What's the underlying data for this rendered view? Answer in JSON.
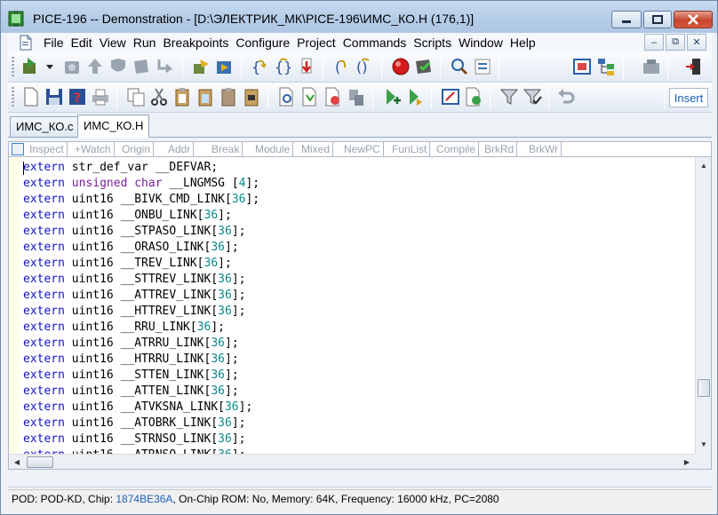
{
  "window": {
    "title": "PICE-196 -- Demonstration - [D:\\ЭЛЕКТРИК_МК\\PICE-196\\ИМС_КО.H (176,1)]"
  },
  "menu": {
    "items": [
      "File",
      "Edit",
      "View",
      "Run",
      "Breakpoints",
      "Configure",
      "Project",
      "Commands",
      "Scripts",
      "Window",
      "Help"
    ]
  },
  "toolbar": {
    "insert_mode": "Insert"
  },
  "tabs": [
    "ИМС_КО.c",
    "ИМС_КО.H"
  ],
  "editor_toolbar": [
    "Inspect",
    "+Watch",
    "Origin",
    "Addr",
    "Break",
    "Module",
    "Mixed",
    "NewPC",
    "FunList",
    "Compile",
    "BrkRd",
    "BrkWr"
  ],
  "code": [
    {
      "kw": "extern",
      "ty": "",
      "plain": " str_def_var __DEFVAR;",
      "num": "",
      "tail": ""
    },
    {
      "kw": "extern",
      "ty": " unsigned char",
      "plain": " __LNGMSG [",
      "num": "4",
      "tail": "];"
    },
    {
      "kw": "extern",
      "ty": "",
      "plain": " uint16 __BIVK_CMD_LINK[",
      "num": "36",
      "tail": "];"
    },
    {
      "kw": "extern",
      "ty": "",
      "plain": " uint16 __ONBU_LINK[",
      "num": "36",
      "tail": "];"
    },
    {
      "kw": "extern",
      "ty": "",
      "plain": " uint16 __STPASO_LINK[",
      "num": "36",
      "tail": "];"
    },
    {
      "kw": "extern",
      "ty": "",
      "plain": " uint16 __ORASO_LINK[",
      "num": "36",
      "tail": "];"
    },
    {
      "kw": "extern",
      "ty": "",
      "plain": " uint16 __TREV_LINK[",
      "num": "36",
      "tail": "];"
    },
    {
      "kw": "extern",
      "ty": "",
      "plain": " uint16 __STTREV_LINK[",
      "num": "36",
      "tail": "];"
    },
    {
      "kw": "extern",
      "ty": "",
      "plain": " uint16 __ATTREV_LINK[",
      "num": "36",
      "tail": "];"
    },
    {
      "kw": "extern",
      "ty": "",
      "plain": " uint16 __HTTREV_LINK[",
      "num": "36",
      "tail": "];"
    },
    {
      "kw": "extern",
      "ty": "",
      "plain": " uint16 __RRU_LINK[",
      "num": "36",
      "tail": "];"
    },
    {
      "kw": "extern",
      "ty": "",
      "plain": " uint16 __ATRRU_LINK[",
      "num": "36",
      "tail": "];"
    },
    {
      "kw": "extern",
      "ty": "",
      "plain": " uint16 __HTRRU_LINK[",
      "num": "36",
      "tail": "];"
    },
    {
      "kw": "extern",
      "ty": "",
      "plain": " uint16 __STTEN_LINK[",
      "num": "36",
      "tail": "];"
    },
    {
      "kw": "extern",
      "ty": "",
      "plain": " uint16 __ATTEN_LINK[",
      "num": "36",
      "tail": "];"
    },
    {
      "kw": "extern",
      "ty": "",
      "plain": " uint16 __ATVKSNA_LINK[",
      "num": "36",
      "tail": "];"
    },
    {
      "kw": "extern",
      "ty": "",
      "plain": " uint16 __ATOBRK_LINK[",
      "num": "36",
      "tail": "];"
    },
    {
      "kw": "extern",
      "ty": "",
      "plain": " uint16 __STRNSO_LINK[",
      "num": "36",
      "tail": "];"
    },
    {
      "kw": "extern",
      "ty": "",
      "plain": " uint16 __ATRNSO_LINK[",
      "num": "36",
      "tail": "];"
    }
  ],
  "status": {
    "pod": "POD: POD-KD,",
    "chip_label": " Chip: ",
    "chip": "1874BE36A",
    "rest": ",  On-Chip ROM: No,  Memory: 64K,  Frequency: 16000 kHz,  PC=2080"
  },
  "colors": {
    "keyword": "#1515c0",
    "type": "#7a1f9e",
    "number": "#0a8a8a",
    "chip_link": "#1b5fb8"
  }
}
